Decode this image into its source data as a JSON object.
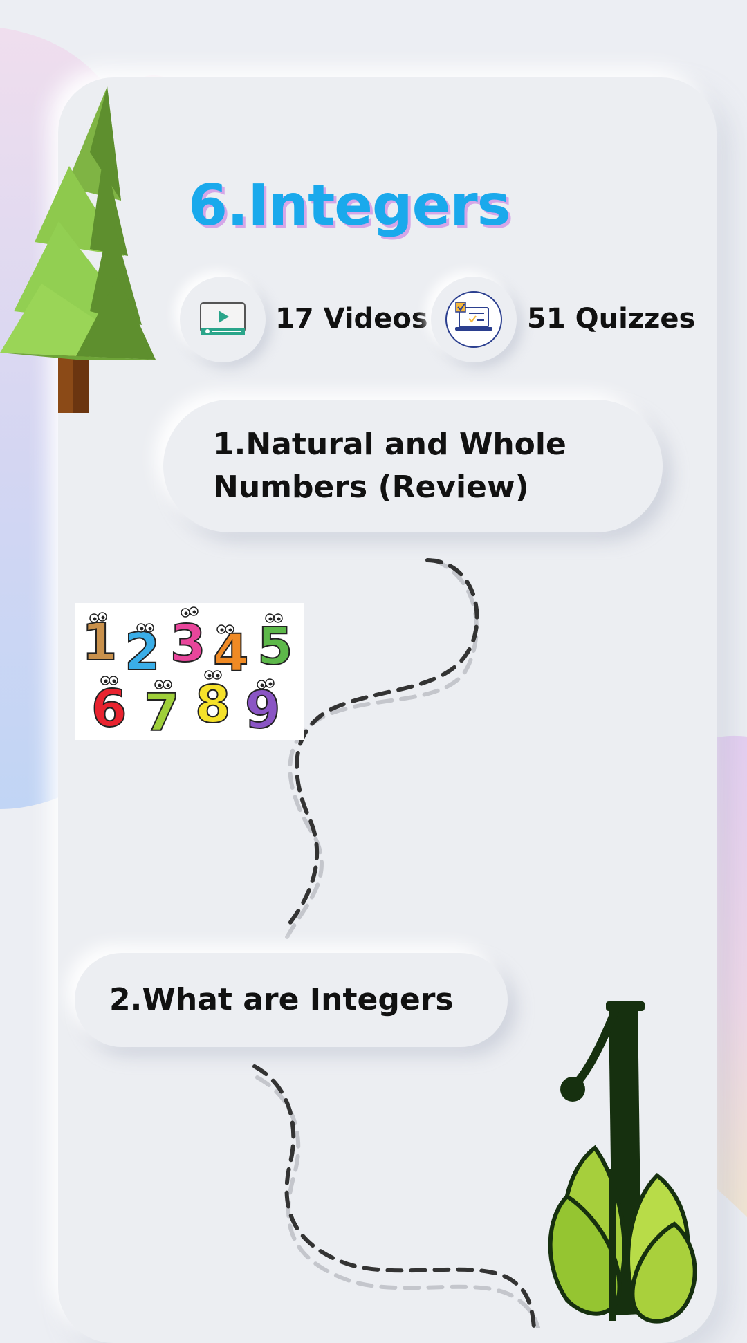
{
  "topic": {
    "title": "6.Integers"
  },
  "stats": {
    "videos": {
      "label": "17 Videos",
      "icon": "video-play-icon"
    },
    "quizzes": {
      "label": "51 Quizzes",
      "icon": "quiz-laptop-icon"
    }
  },
  "lessons": [
    {
      "title": "1.Natural and Whole Numbers (Review)"
    },
    {
      "title": "2.What are Integers"
    }
  ],
  "illustrations": {
    "numbers_image": {
      "digits": [
        "1",
        "2",
        "3",
        "4",
        "5",
        "6",
        "7",
        "8",
        "9"
      ]
    }
  },
  "colors": {
    "title": "#1aa9ec",
    "title_shadow": "#d5a6e8",
    "background": "#eceef3",
    "path_dark": "#333333",
    "path_light": "#c4c6cc"
  }
}
